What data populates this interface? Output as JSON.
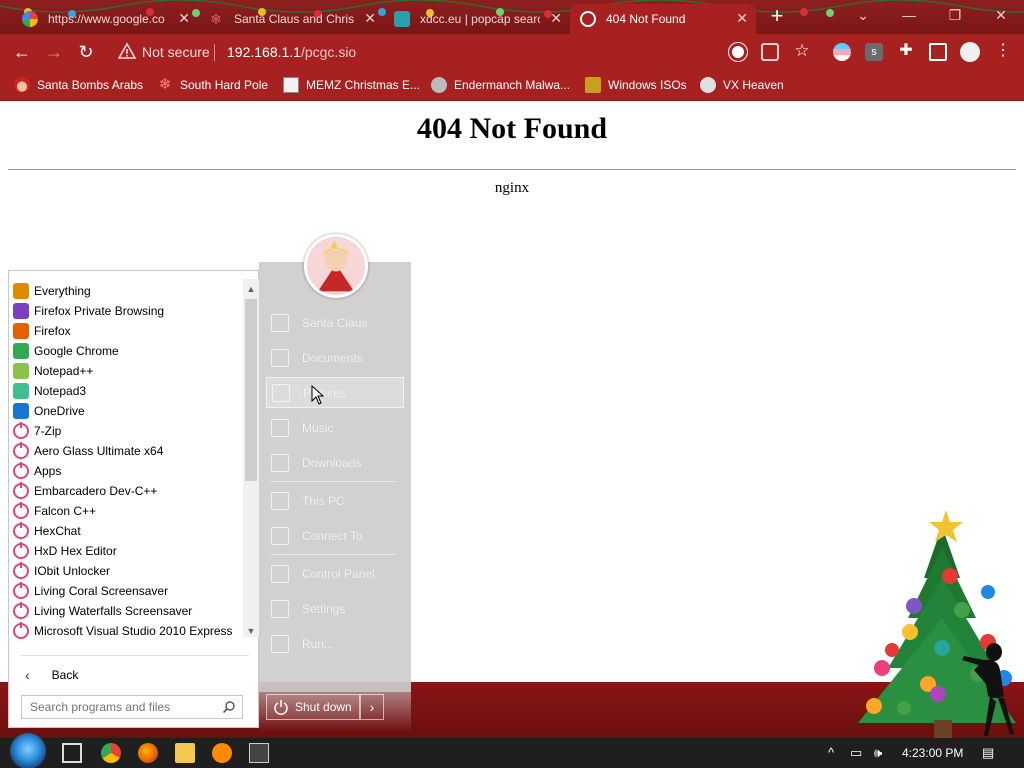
{
  "browser": {
    "tabs": [
      {
        "title": "https://www.google.co",
        "favicon": "google-icon"
      },
      {
        "title": "Santa Claus and Chris",
        "favicon": "snowflake-icon"
      },
      {
        "title": "xdcc.eu | popcap searc",
        "favicon": "xdcc-icon"
      },
      {
        "title": "404 Not Found",
        "favicon": "globe-icon",
        "active": true
      }
    ],
    "new_tab": "+",
    "security_label": "Not secure",
    "url_host": "192.168.1.1",
    "url_path": "/pcgc.sio",
    "bookmarks": [
      {
        "label": "Santa Bombs Arabs",
        "icon": "santa-icon"
      },
      {
        "label": "South Hard Pole",
        "icon": "snowflake-icon"
      },
      {
        "label": "MEMZ Christmas E...",
        "icon": "window-icon"
      },
      {
        "label": "Endermanch Malwa...",
        "icon": "raccoon-icon"
      },
      {
        "label": "Windows ISOs",
        "icon": "gift-icon"
      },
      {
        "label": "VX Heaven",
        "icon": "vx-icon"
      }
    ]
  },
  "page": {
    "heading": "404 Not Found",
    "server": "nginx"
  },
  "start_menu": {
    "programs": [
      {
        "label": "Everything",
        "icon": "magnifier-icon",
        "color": "#e08a00"
      },
      {
        "label": "Firefox Private Browsing",
        "icon": "firefox-private-icon",
        "color": "#7b3fc4"
      },
      {
        "label": "Firefox",
        "icon": "firefox-icon",
        "color": "#e66000"
      },
      {
        "label": "Google Chrome",
        "icon": "chrome-icon",
        "color": "#34a853"
      },
      {
        "label": "Notepad++",
        "icon": "notepadpp-icon",
        "color": "#8bc34a"
      },
      {
        "label": "Notepad3",
        "icon": "notepad3-icon",
        "color": "#3fbf8f"
      },
      {
        "label": "OneDrive",
        "icon": "onedrive-icon",
        "color": "#1976d2"
      },
      {
        "label": "7-Zip",
        "icon": "power-icon",
        "color": "#e0457a"
      },
      {
        "label": "Aero Glass Ultimate x64",
        "icon": "power-icon",
        "color": "#e0457a"
      },
      {
        "label": "Apps",
        "icon": "power-icon",
        "color": "#e0457a"
      },
      {
        "label": "Embarcadero Dev-C++",
        "icon": "power-icon",
        "color": "#e0457a"
      },
      {
        "label": "Falcon C++",
        "icon": "power-icon",
        "color": "#e0457a"
      },
      {
        "label": "HexChat",
        "icon": "power-icon",
        "color": "#e0457a"
      },
      {
        "label": "HxD Hex Editor",
        "icon": "power-icon",
        "color": "#e0457a"
      },
      {
        "label": "IObit Unlocker",
        "icon": "power-icon",
        "color": "#e0457a"
      },
      {
        "label": "Living Coral Screensaver",
        "icon": "power-icon",
        "color": "#e0457a"
      },
      {
        "label": "Living Waterfalls Screensaver",
        "icon": "power-icon",
        "color": "#e0457a"
      },
      {
        "label": "Microsoft Visual Studio 2010 Express",
        "icon": "power-icon",
        "color": "#e0457a"
      }
    ],
    "back_label": "Back",
    "search_placeholder": "Search programs and files",
    "right_items": [
      {
        "label": "Santa Claus",
        "icon": "user-folder-icon"
      },
      {
        "label": "Documents",
        "icon": "documents-icon"
      },
      {
        "label": "Pictures",
        "icon": "pictures-icon",
        "highlighted": true
      },
      {
        "label": "Music",
        "icon": "music-icon"
      },
      {
        "label": "Downloads",
        "icon": "downloads-icon"
      },
      {
        "label": "This PC",
        "icon": "computer-icon"
      },
      {
        "label": "Connect To",
        "icon": "connect-icon"
      },
      {
        "label": "Control Panel",
        "icon": "control-panel-icon"
      },
      {
        "label": "Settings",
        "icon": "settings-icon"
      },
      {
        "label": "Run...",
        "icon": "run-icon"
      }
    ],
    "shutdown_label": "Shut down"
  },
  "taskbar": {
    "clock": "4:23:00 PM"
  }
}
